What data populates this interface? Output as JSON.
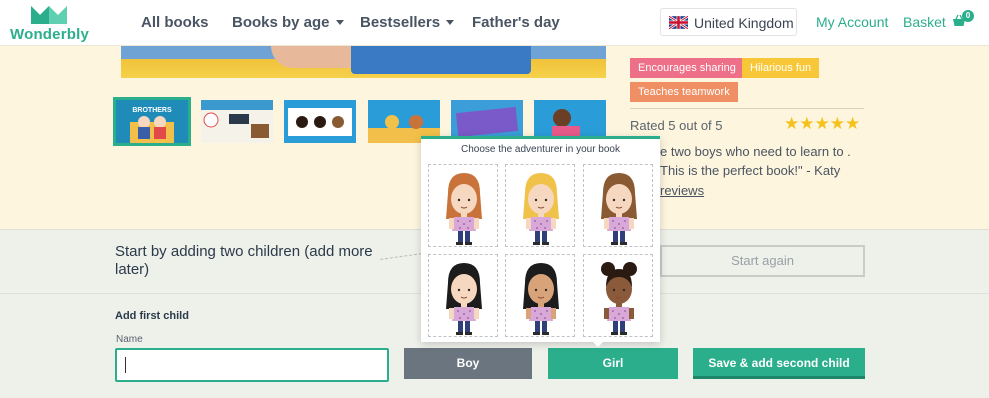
{
  "header": {
    "logo_text": "Wonderbly",
    "nav": [
      {
        "label": "All books",
        "has_dropdown": false
      },
      {
        "label": "Books by age",
        "has_dropdown": true
      },
      {
        "label": "Bestsellers",
        "has_dropdown": true
      },
      {
        "label": "Father's day",
        "has_dropdown": false
      }
    ],
    "country": "United Kingdom",
    "my_account": "My Account",
    "basket": "Basket",
    "basket_count": "0"
  },
  "product": {
    "tags": [
      "Encourages sharing",
      "Hilarious fun",
      "Teaches teamwork"
    ],
    "rated": "Rated 5 out of 5",
    "stars": "★★★★★",
    "review_text": "e two boys who need to learn to . This is the perfect book!\" - Katy",
    "reviews_link": "reviews",
    "thumb_label": "BROTHERS"
  },
  "builder": {
    "start_title": "Start by adding two children (add more later)",
    "start_again": "Start again",
    "add_first_child": "Add first child",
    "name_label": "Name",
    "name_value": "",
    "boy": "Boy",
    "girl": "Girl",
    "save_add": "Save & add second child"
  },
  "popup": {
    "title": "Choose the adventurer in your book",
    "characters": [
      {
        "hair": "#c9723a",
        "skin": "#f6d7c0",
        "style": "long"
      },
      {
        "hair": "#f1c24a",
        "skin": "#f6d7c0",
        "style": "long"
      },
      {
        "hair": "#8a5a33",
        "skin": "#f6d7c0",
        "style": "long"
      },
      {
        "hair": "#1c1c1c",
        "skin": "#f6d7c0",
        "style": "long"
      },
      {
        "hair": "#1c1c1c",
        "skin": "#d9a37a",
        "style": "long"
      },
      {
        "hair": "#2b1a12",
        "skin": "#8a5a3b",
        "style": "buns"
      }
    ]
  },
  "colors": {
    "brand": "#2bae8c",
    "page_bg": "#fdf5dd",
    "boy_button": "#6a7580",
    "star": "#f5c21b"
  }
}
